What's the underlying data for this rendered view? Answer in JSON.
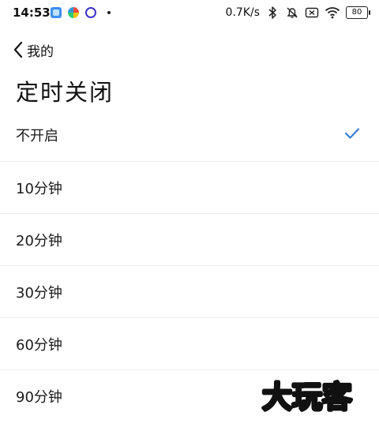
{
  "status_bar": {
    "time": "14:53",
    "net_speed": "0.7K/s",
    "battery": "80",
    "icons": [
      "app-icon-blue",
      "app-icon-colorful",
      "app-icon-ring",
      "dot",
      "bluetooth-icon",
      "mute-bell-icon",
      "sim-off-icon",
      "wifi-icon",
      "battery-icon"
    ]
  },
  "header": {
    "back_label": "我的",
    "title": "定时关闭"
  },
  "options": [
    {
      "label": "不开启",
      "selected": true
    },
    {
      "label": "10分钟",
      "selected": false
    },
    {
      "label": "20分钟",
      "selected": false
    },
    {
      "label": "30分钟",
      "selected": false
    },
    {
      "label": "60分钟",
      "selected": false
    },
    {
      "label": "90分钟",
      "selected": false
    }
  ],
  "watermark": "大玩客",
  "colors": {
    "accent": "#3a7bd5",
    "divider": "#ececec",
    "text": "#1a1a1a"
  }
}
